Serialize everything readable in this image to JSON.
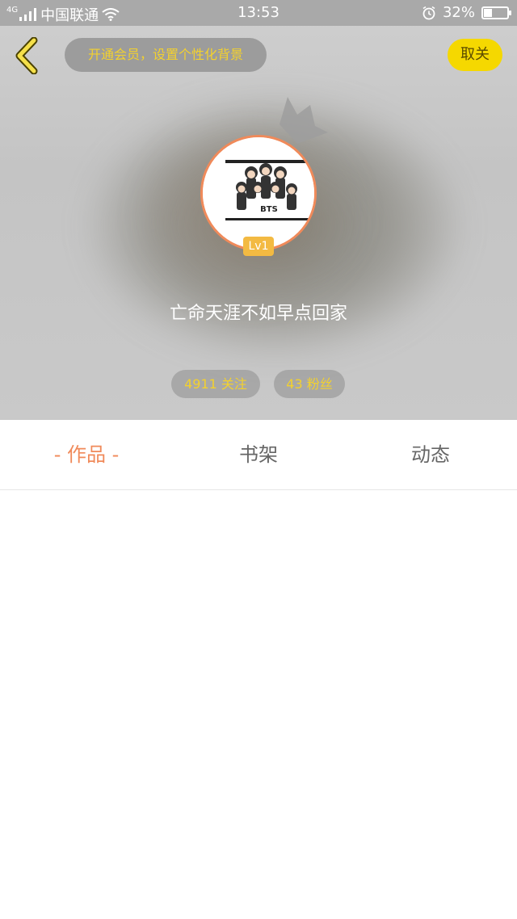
{
  "status_bar": {
    "network_badge": "4G",
    "carrier": "中国联通",
    "time": "13:53",
    "battery_percent": "32%",
    "battery_level": 0.32,
    "icons": [
      "signal-icon",
      "wifi-icon",
      "alarm-icon",
      "battery-icon"
    ]
  },
  "header": {
    "back_icon": "chevron-left-icon",
    "vip_promo": "开通会员，设置个性化背景",
    "close_label": "取关",
    "level": "Lv1",
    "username": "亡命天涯不如早点回家",
    "following": "4911 关注",
    "fans": "43 粉丝",
    "avatar_text": "BTS"
  },
  "tabs": [
    {
      "label": "- 作品 -",
      "active": true
    },
    {
      "label": "书架",
      "active": false
    },
    {
      "label": "动态",
      "active": false
    }
  ],
  "colors": {
    "accent_orange": "#f08a5a",
    "accent_yellow": "#f5d800",
    "stat_text": "#f3d12e"
  }
}
